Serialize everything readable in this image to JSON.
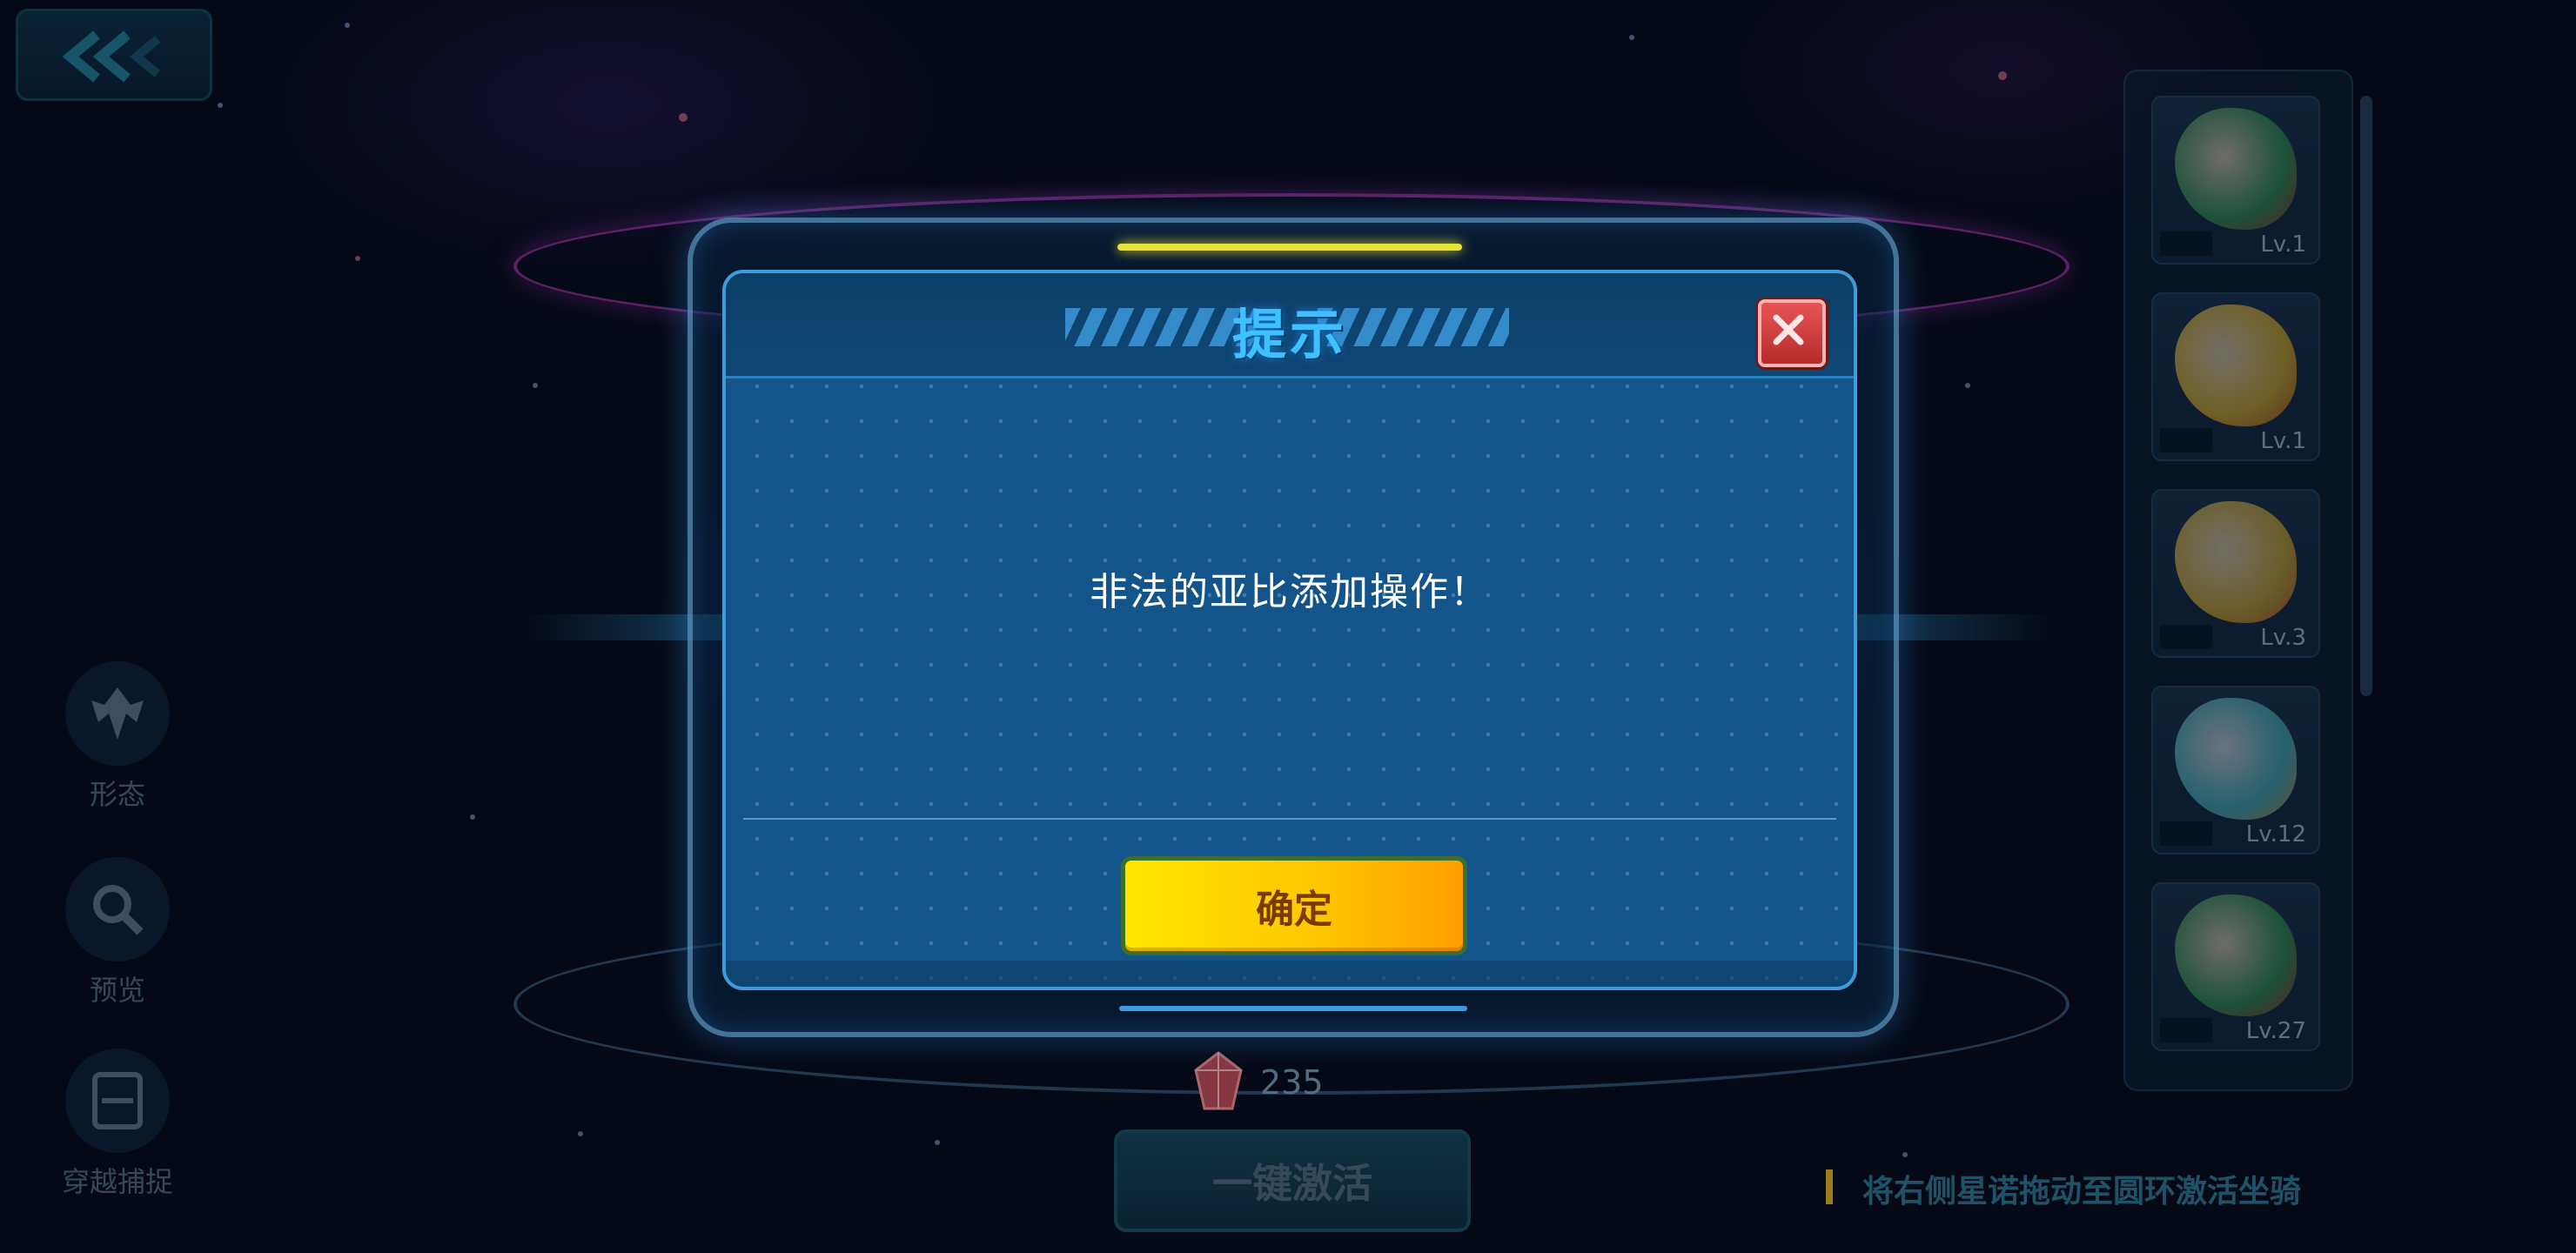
{
  "dialog": {
    "title": "提示",
    "message": "非法的亚比添加操作！",
    "confirm_label": "确定",
    "close_icon": "close-icon"
  },
  "sidebar": {
    "items": [
      {
        "label": "形态",
        "icon": "form-icon"
      },
      {
        "label": "预览",
        "icon": "search-icon"
      },
      {
        "label": "穿越捕捉",
        "icon": "capture-icon"
      }
    ]
  },
  "pet_list": {
    "cards": [
      {
        "level": "Lv.1"
      },
      {
        "level": "Lv.1"
      },
      {
        "level": "Lv.3"
      },
      {
        "level": "Lv.12"
      },
      {
        "level": "Lv.27"
      }
    ]
  },
  "bottom": {
    "gem_count": "235",
    "activate_label": "一键激活",
    "hint": "将右侧星诺拖动至圆环激活坐骑"
  },
  "colors": {
    "accent": "#3fc0ff",
    "confirm": "#ffc800",
    "close": "#d64343"
  }
}
